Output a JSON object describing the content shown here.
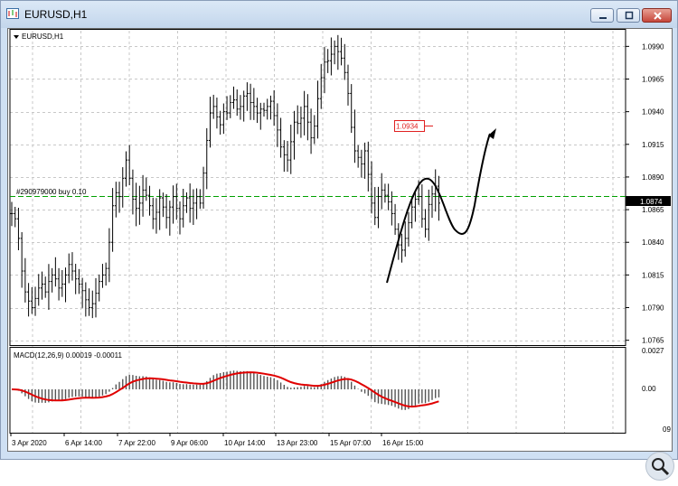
{
  "window": {
    "title": "EURUSD,H1",
    "controls": {
      "minimize": "minimize-icon",
      "maximize": "maximize-icon",
      "close": "close-icon"
    }
  },
  "chart": {
    "symbol_label": "EURUSD,H1",
    "order_label": "#290979000 buy 0.10",
    "current_price": "1.0874",
    "target_price": "1.0934",
    "price_ticks": [
      "1.0990",
      "1.0965",
      "1.0940",
      "1.0915",
      "1.0890",
      "1.0865",
      "1.0840",
      "1.0815",
      "1.0790",
      "1.0765"
    ],
    "time_labels": [
      "3 Apr 2020",
      "6 Apr 14:00",
      "7 Apr 22:00",
      "9 Apr 06:00",
      "10 Apr 14:00",
      "13 Apr 23:00",
      "15 Apr 07:00",
      "16 Apr 15:00"
    ],
    "colors": {
      "grid": "#c8c8c8",
      "candle": "#000000",
      "order_line": "#00a000",
      "price_box": "#000000",
      "target": "#e02020",
      "signal": "#e00000"
    }
  },
  "macd": {
    "label": "MACD(12,26,9) 0.00019 -0.00011",
    "ticks": [
      "0.0027",
      "0.00"
    ],
    "partial_tick": "09"
  },
  "chart_data": {
    "type": "bar",
    "title": "EURUSD,H1",
    "ylim": [
      1.0762,
      1.1002
    ],
    "series": [
      {
        "name": "EURUSD",
        "values": [
          1.0862,
          1.0858,
          1.0843,
          1.0818,
          1.0802,
          1.0795,
          1.079,
          1.0797,
          1.0805,
          1.0808,
          1.0802,
          1.081,
          1.0815,
          1.0812,
          1.0805,
          1.0808,
          1.0815,
          1.0823,
          1.0818,
          1.0812,
          1.0808,
          1.0803,
          1.0796,
          1.079,
          1.0793,
          1.0801,
          1.081,
          1.0815,
          1.082,
          1.084,
          1.0868,
          1.0878,
          1.0875,
          1.0889,
          1.0903,
          1.0889,
          1.0873,
          1.0866,
          1.087,
          1.088,
          1.0876,
          1.0868,
          1.0858,
          1.0863,
          1.0874,
          1.0867,
          1.0859,
          1.0867,
          1.0875,
          1.0866,
          1.0858,
          1.0868,
          1.0874,
          1.0866,
          1.087,
          1.0875,
          1.087,
          1.0893,
          1.0918,
          1.0939,
          1.0944,
          1.0936,
          1.093,
          1.094,
          1.0939,
          1.0947,
          1.0949,
          1.0942,
          1.0944,
          1.0952,
          1.0954,
          1.0947,
          1.0944,
          1.0939,
          1.0942,
          1.0941,
          1.0944,
          1.0948,
          1.0937,
          1.0926,
          1.0913,
          1.0907,
          1.0903,
          1.0917,
          1.0932,
          1.0931,
          1.0935,
          1.0944,
          1.0932,
          1.092,
          1.0929,
          1.095,
          1.0966,
          1.0978,
          1.0979,
          1.0984,
          1.099,
          1.0986,
          1.0981,
          1.097,
          1.0954,
          1.0928,
          1.091,
          1.0905,
          1.09,
          1.091,
          1.0892,
          1.087,
          1.0859,
          1.0875,
          1.088,
          1.0876,
          1.0871,
          1.0862,
          1.085,
          1.0838,
          1.0834,
          1.0843,
          1.0855,
          1.0867,
          1.0873,
          1.0875,
          1.0858,
          1.085,
          1.0869,
          1.0877,
          1.0883,
          1.087
        ]
      }
    ]
  }
}
